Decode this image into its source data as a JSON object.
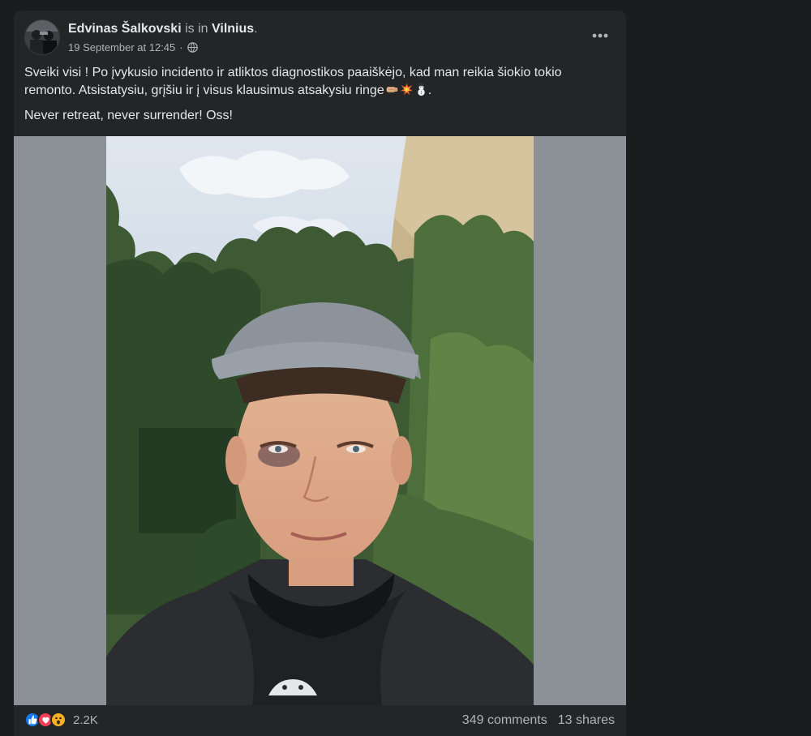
{
  "post": {
    "author": "Edvinas Šalkovski",
    "is_in": " is in ",
    "location": "Vilnius",
    "period": ".",
    "timestamp": "19 September at 12:45",
    "meta_separator": "·",
    "audience_icon": "globe-icon",
    "more_icon": "more-options-icon",
    "text_line1": "Sveiki visi ! Po įvykusio incidento ir atliktos diagnostikos paaiškėjo, kad man reikia šiokio tokio remonto. Atsistatysiu, grįšiu ir į visus klausimus atsakysiu ringe",
    "text_line1_emojis": [
      "fist-bump-emoji",
      "collision-emoji",
      "snowman-emoji"
    ],
    "text_line1_end": ".",
    "text_line2": "Never retreat, never surrender! Oss!"
  },
  "footer": {
    "reactions": [
      "like-reaction-icon",
      "love-reaction-icon",
      "wow-reaction-icon"
    ],
    "reaction_count": "2.2K",
    "comments": "349 comments",
    "shares": "13 shares"
  },
  "colors": {
    "background": "#1b1c1e",
    "card": "#242526",
    "primary_text": "#e4e6eb",
    "secondary_text": "#b0b3b8",
    "like_blue": "#1877f2",
    "love_red": "#f33e58",
    "wow_yellow": "#f7b125"
  }
}
